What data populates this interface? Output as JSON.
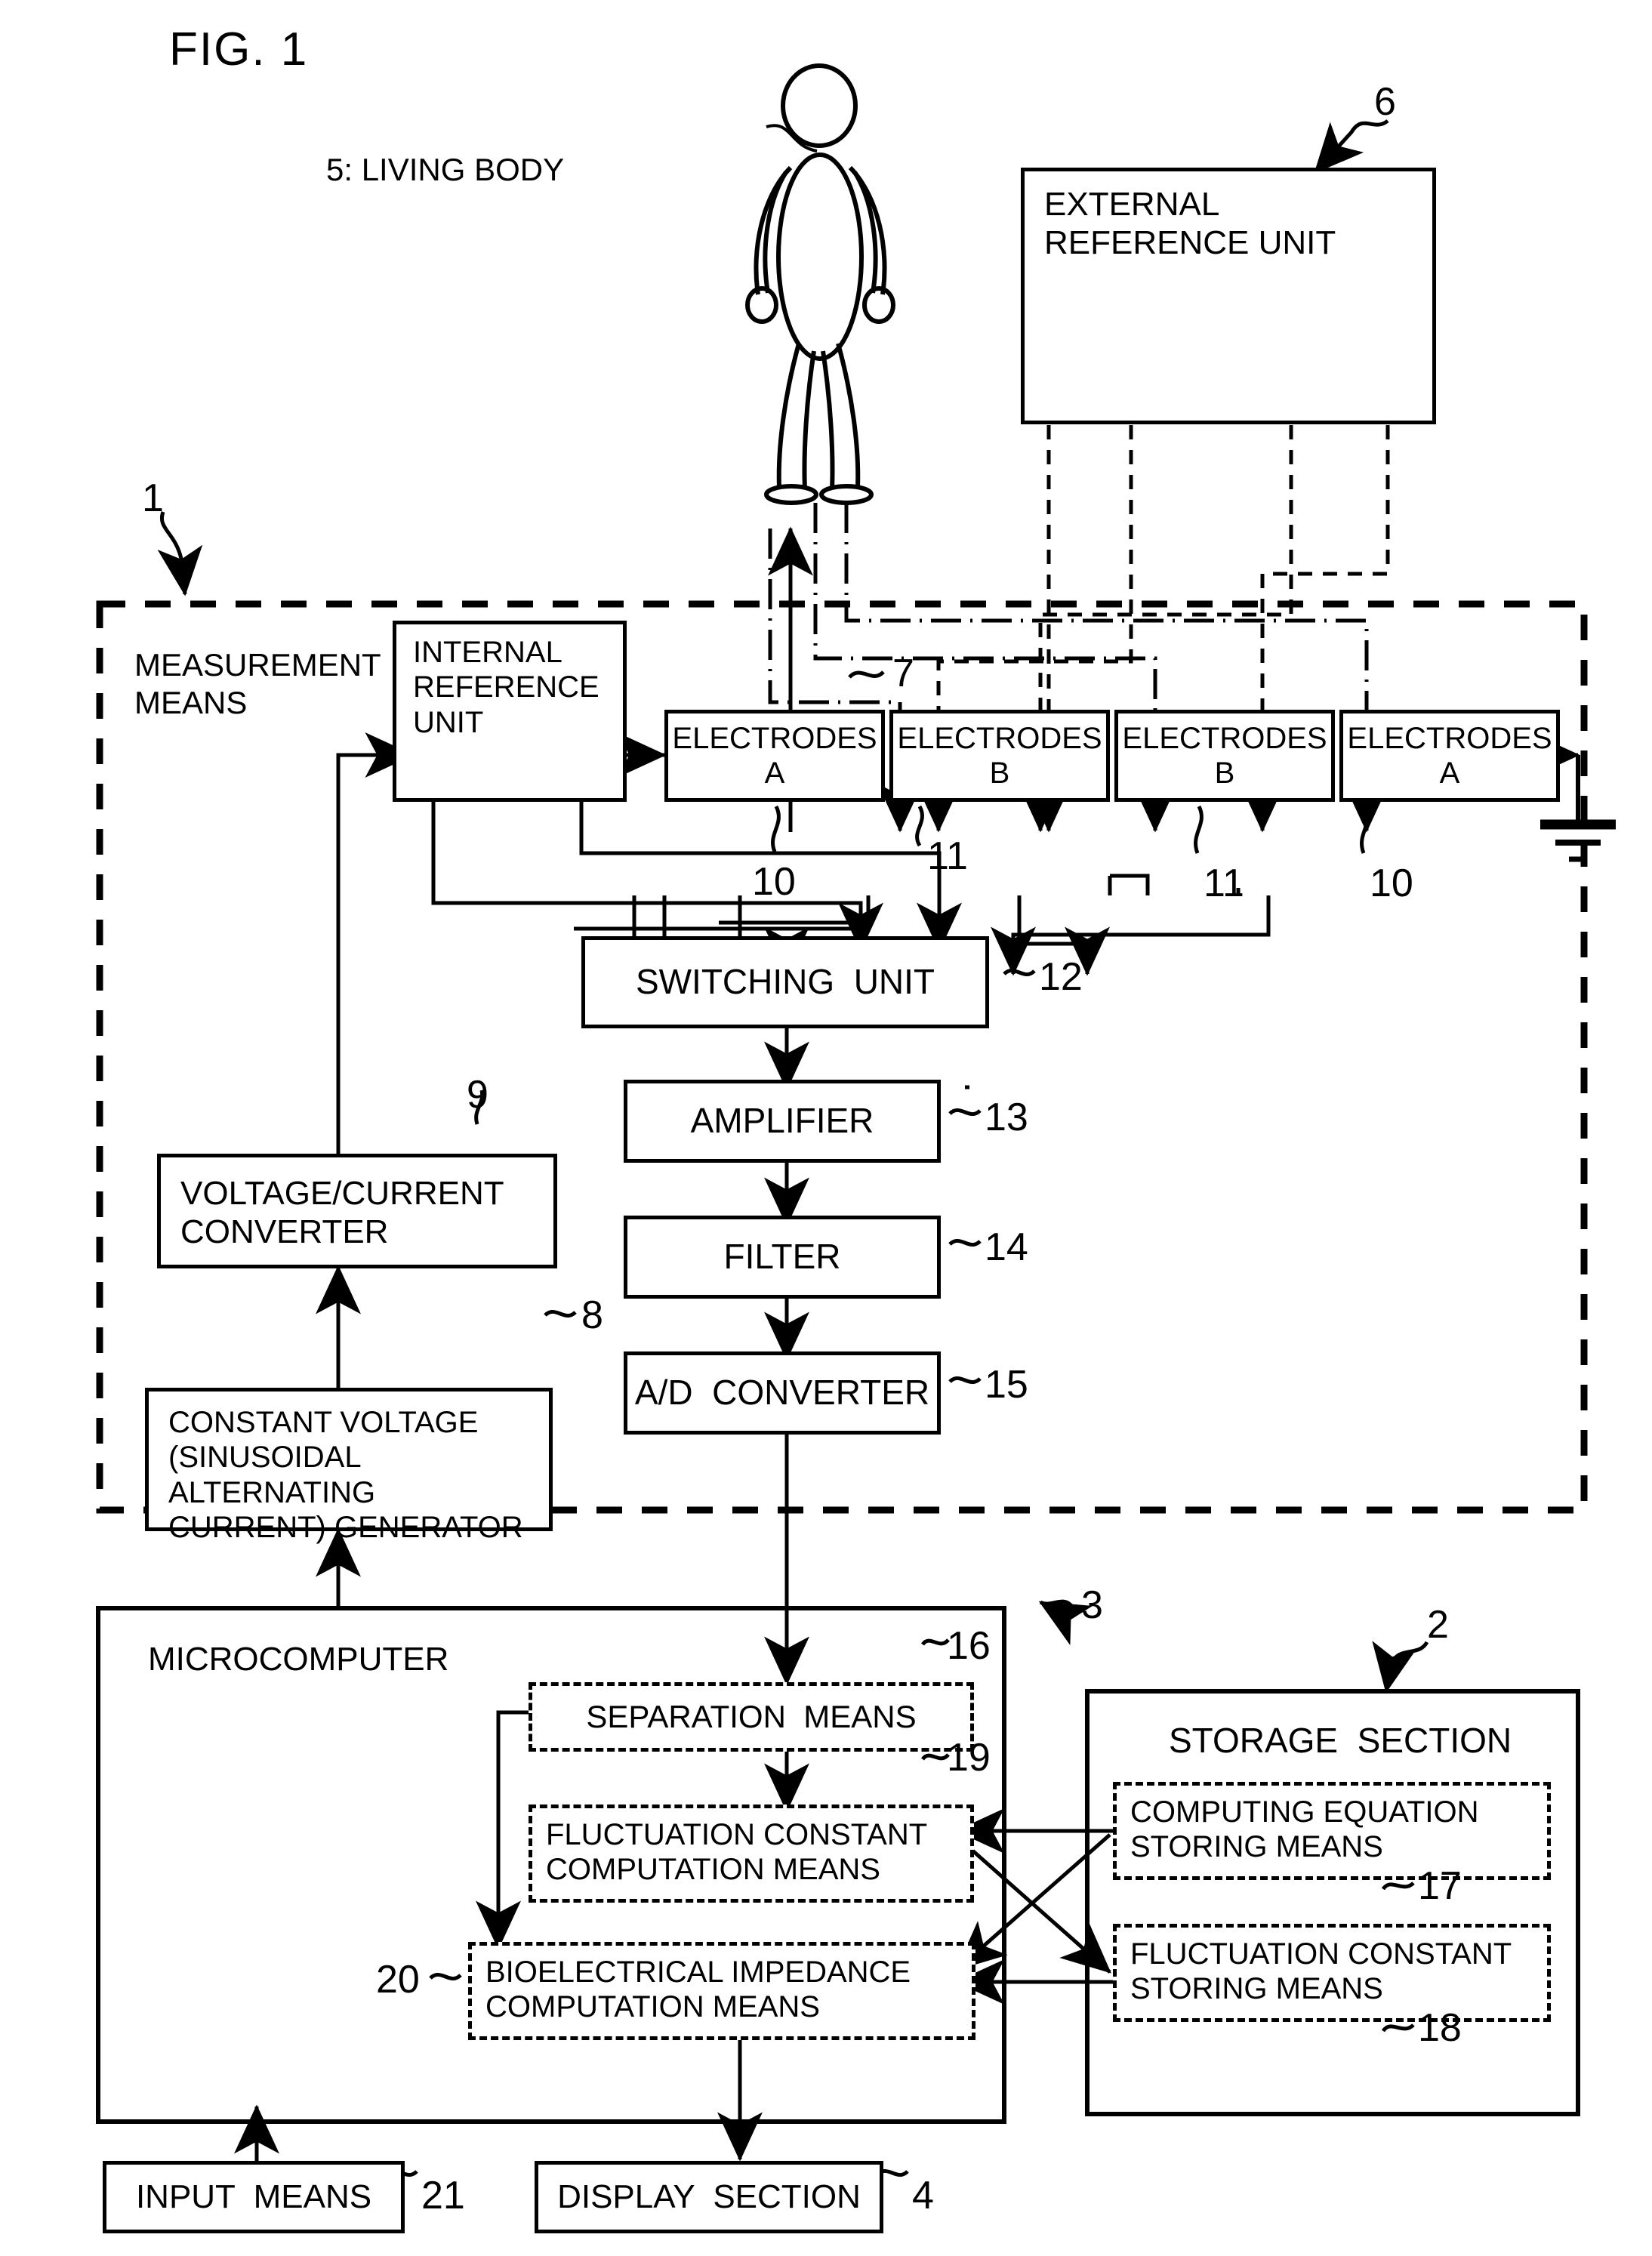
{
  "figure": {
    "title": "FIG. 1"
  },
  "labels": {
    "living_body": "5: LIVING BODY",
    "measurement_means": "MEASUREMENT\nMEANS",
    "microcomputer": "MICROCOMPUTER"
  },
  "blocks": {
    "external_reference_unit": {
      "label": "EXTERNAL\nREFERENCE UNIT",
      "ref": "6"
    },
    "internal_reference_unit": {
      "label": "INTERNAL\nREFERENCE\nUNIT",
      "ref": "7"
    },
    "electrodes_a_left": {
      "label": "ELECTRODES\nA",
      "ref": "10"
    },
    "electrodes_b_left": {
      "label": "ELECTRODES\nB",
      "ref": "11"
    },
    "electrodes_b_right": {
      "label": "ELECTRODES\nB",
      "ref": "11"
    },
    "electrodes_a_right": {
      "label": "ELECTRODES\nA",
      "ref": "10"
    },
    "switching_unit": {
      "label": "SWITCHING  UNIT",
      "ref": "12"
    },
    "amplifier": {
      "label": "AMPLIFIER",
      "ref": "13"
    },
    "filter": {
      "label": "FILTER",
      "ref": "14"
    },
    "ad_converter": {
      "label": "A/D  CONVERTER",
      "ref": "15"
    },
    "voltage_current_converter": {
      "label": "VOLTAGE/CURRENT\nCONVERTER",
      "ref": "9"
    },
    "constant_voltage_generator": {
      "label": "CONSTANT VOLTAGE\n(SINUSOIDAL\nALTERNATING\nCURRENT) GENERATOR",
      "ref": "8"
    },
    "separation_means": {
      "label": "SEPARATION  MEANS",
      "ref": "16"
    },
    "fluctuation_constant_computation_means": {
      "label": "FLUCTUATION CONSTANT\nCOMPUTATION MEANS",
      "ref": "19"
    },
    "bioelectrical_impedance_computation_means": {
      "label": "BIOELECTRICAL IMPEDANCE\nCOMPUTATION MEANS",
      "ref": "20"
    },
    "storage_section": {
      "label": "STORAGE  SECTION",
      "ref": "2"
    },
    "computing_equation_storing_means": {
      "label": "COMPUTING EQUATION\nSTORING MEANS",
      "ref": "17"
    },
    "fluctuation_constant_storing_means": {
      "label": "FLUCTUATION CONSTANT\nSTORING MEANS",
      "ref": "18"
    },
    "input_means": {
      "label": "INPUT  MEANS",
      "ref": "21"
    },
    "display_section": {
      "label": "DISPLAY  SECTION",
      "ref": "4"
    }
  },
  "refs": {
    "measurement_means_block": "1",
    "microcomputer_block": "3"
  },
  "colors": {
    "ink": "#000000",
    "paper": "#ffffff"
  }
}
